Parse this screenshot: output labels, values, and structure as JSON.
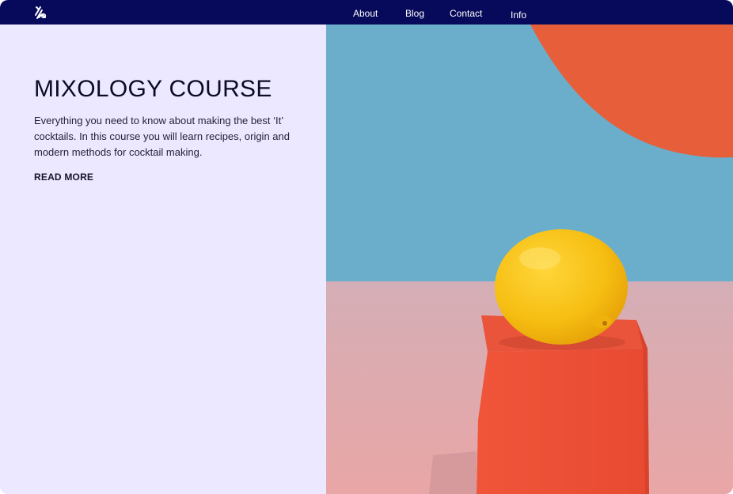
{
  "nav": {
    "logo_icon": "logo-icon",
    "links": [
      {
        "label": "About"
      },
      {
        "label": "Blog"
      },
      {
        "label": "Contact"
      },
      {
        "label": "Info"
      }
    ]
  },
  "hero": {
    "title": "MIXOLOGY COURSE",
    "description": "Everything you need to know about making the best ‘It’ cocktails. In this course you will learn recipes, origin and modern methods for cocktail making.",
    "read_more_label": "READ MORE",
    "image_subject": "lemon-on-red-cube"
  },
  "colors": {
    "nav_background": "#070A5A",
    "panel_background": "#ECE8FF",
    "sky_blue": "#6AAECB",
    "orange_shape": "#E65F3A",
    "floor_pink": "#D9B3B7",
    "cube_red": "#EE5236",
    "lemon_yellow": "#F6BE12"
  }
}
